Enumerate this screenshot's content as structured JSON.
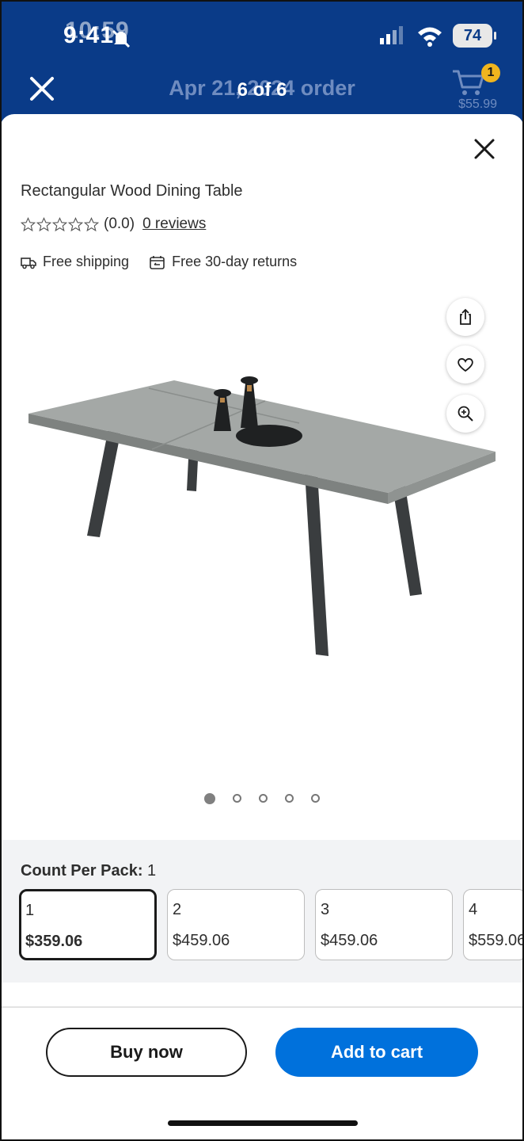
{
  "status_bar": {
    "time": "9:41",
    "time_ghost": "10:59",
    "battery": "74"
  },
  "nav": {
    "title": "Apr 21, 2024 order",
    "overlay": "6 of 6",
    "cart_count": "1",
    "cart_total": "$55.99"
  },
  "product": {
    "title": "Rectangular Wood Dining Table",
    "rating": "(0.0)",
    "reviews": "0 reviews",
    "perks": [
      "Free shipping",
      "Free 30-day returns"
    ]
  },
  "gallery": {
    "image_count": 5,
    "active_index": 0,
    "actions": [
      "share-icon",
      "heart-icon",
      "zoom-in-icon"
    ]
  },
  "variants": {
    "label": "Count Per Pack:",
    "selected_value": "1",
    "options": [
      {
        "qty": "1",
        "price": "$359.06"
      },
      {
        "qty": "2",
        "price": "$459.06"
      },
      {
        "qty": "3",
        "price": "$459.06"
      },
      {
        "qty": "4",
        "price": "$559.06"
      }
    ]
  },
  "actions": {
    "buy_now": "Buy now",
    "add_to_cart": "Add to cart"
  },
  "colors": {
    "header": "#0a3b88",
    "primary": "#0071dc",
    "badge": "#f0b51e"
  }
}
